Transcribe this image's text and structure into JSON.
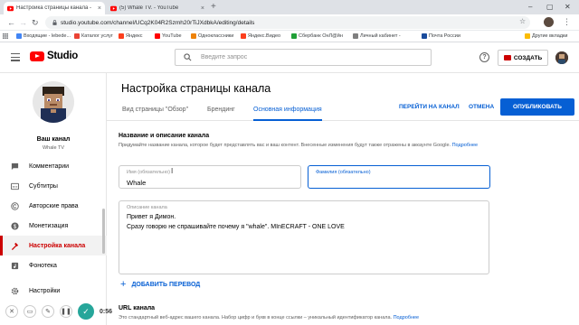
{
  "browser": {
    "tabs": [
      {
        "label": "Настройка страницы канала - ",
        "active": true
      },
      {
        "label": "(5) Whale TV. - YouTube",
        "active": false
      }
    ],
    "new_tab": "+",
    "url": "studio.youtube.com/channel/UCq2K04R2Szmh20rTiJXdbkA/editing/details",
    "bookmarks": [
      {
        "label": "Входящие - lebede...",
        "color": "#4285f4"
      },
      {
        "label": "Каталог услуг",
        "color": "#ea4335"
      },
      {
        "label": "Яндекс",
        "color": "#fc3f1d"
      },
      {
        "label": "YouTube",
        "color": "#ff0000"
      },
      {
        "label": "Одноклассники",
        "color": "#ee8208"
      },
      {
        "label": "Яндекс.Видео",
        "color": "#fc3f1d"
      },
      {
        "label": "Сбербанк ОнЛ@йн",
        "color": "#21a038"
      },
      {
        "label": "Личный кабинет -",
        "color": "#7f7f7f"
      },
      {
        "label": "Почта России",
        "color": "#1a4b9c"
      },
      {
        "label": "Другие вкладки",
        "color": "#fbbc04"
      }
    ]
  },
  "studio": {
    "logo_word": "Studio",
    "search_placeholder": "Введите запрос",
    "help_icon": "?",
    "create_label": "СОЗДАТЬ"
  },
  "sidebar": {
    "channel_title": "Ваш канал",
    "channel_name": "Whale TV",
    "items": [
      {
        "label": "Комментарии",
        "icon": "comment-icon",
        "active": false
      },
      {
        "label": "Субтитры",
        "icon": "subtitles-icon",
        "active": false
      },
      {
        "label": "Авторские права",
        "icon": "copyright-icon",
        "active": false
      },
      {
        "label": "Монетизация",
        "icon": "dollar-icon",
        "active": false
      },
      {
        "label": "Настройка канала",
        "icon": "customization-icon",
        "active": true
      },
      {
        "label": "Фонотека",
        "icon": "audio-library-icon",
        "active": false
      },
      {
        "label": "Настройки",
        "icon": "gear-icon",
        "active": false
      }
    ]
  },
  "main": {
    "title": "Настройка страницы канала",
    "tabs": [
      {
        "label": "Вид страницы \"Обзор\"",
        "active": false
      },
      {
        "label": "Брендинг",
        "active": false
      },
      {
        "label": "Основная информация",
        "active": true
      }
    ],
    "go_to_channel": "ПЕРЕЙТИ НА КАНАЛ",
    "cancel": "ОТМЕНА",
    "publish": "ОПУБЛИКОВАТЬ",
    "name_section": {
      "title": "Название и описание канала",
      "desc": "Придумайте название канала, которое будет представлять вас и ваш контент. Внесенные изменения будут также отражены в аккаунте Google.",
      "more": "Подробнее"
    },
    "first_name": {
      "label": "Имя (обязательно)",
      "value": "Whale"
    },
    "last_name": {
      "label": "Фамилия (обязательно)",
      "value": ""
    },
    "description": {
      "label": "Описание канала",
      "lines": [
        "Привет я Димон.",
        "Сразу говорю не спрашивайте почему я \"whale\". MInECRAFT - ONE LOVE"
      ]
    },
    "add_translation": "ДОБАВИТЬ ПЕРЕВОД",
    "url_section": {
      "title": "URL канала",
      "desc": "Это стандартный веб-адрес вашего канала. Набор цифр и букв в конце ссылки – уникальный идентификатор канала.",
      "more": "Подробнее"
    }
  },
  "recorder": {
    "time": "0:56"
  }
}
